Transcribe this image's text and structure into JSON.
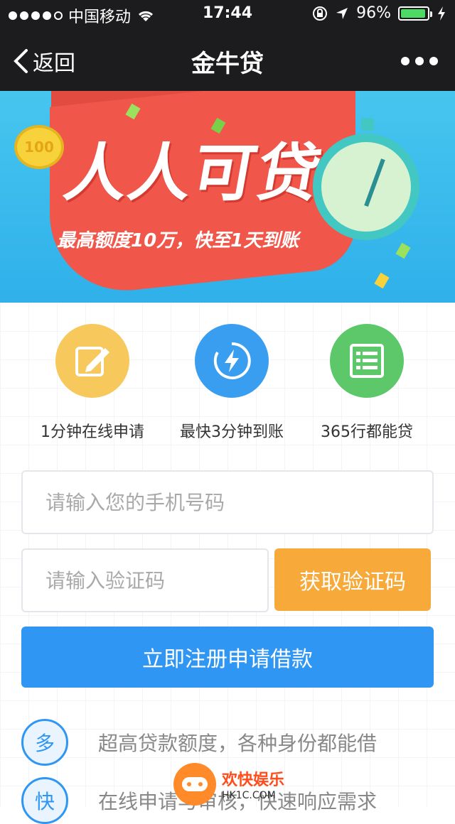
{
  "status_bar": {
    "carrier": "中国移动",
    "time": "17:44",
    "battery": "96%"
  },
  "nav": {
    "back_label": "返回",
    "title": "金牛贷"
  },
  "banner": {
    "title": "人人可贷",
    "subtitle": "最高额度10万，快至1天到账",
    "coin_text": "100"
  },
  "features": [
    {
      "label": "1分钟在线申请",
      "color": "#f7c95c"
    },
    {
      "label": "最快3分钟到账",
      "color": "#3a9ef0"
    },
    {
      "label": "365行都能贷",
      "color": "#5cc86a"
    }
  ],
  "form": {
    "phone_placeholder": "请输入您的手机号码",
    "code_placeholder": "请输入验证码",
    "get_code_label": "获取验证码",
    "submit_label": "立即注册申请借款"
  },
  "benefits": [
    {
      "badge": "多",
      "text": "超高贷款额度，各种身份都能借"
    },
    {
      "badge": "快",
      "text": "在线申请与审核，快速响应需求"
    }
  ],
  "watermark": {
    "title": "欢快娱乐",
    "domain": "HK1C.COM"
  },
  "colors": {
    "accent_blue": "#2f96f3",
    "accent_orange": "#f7a93a",
    "nav_bg": "#1c1c1e"
  }
}
